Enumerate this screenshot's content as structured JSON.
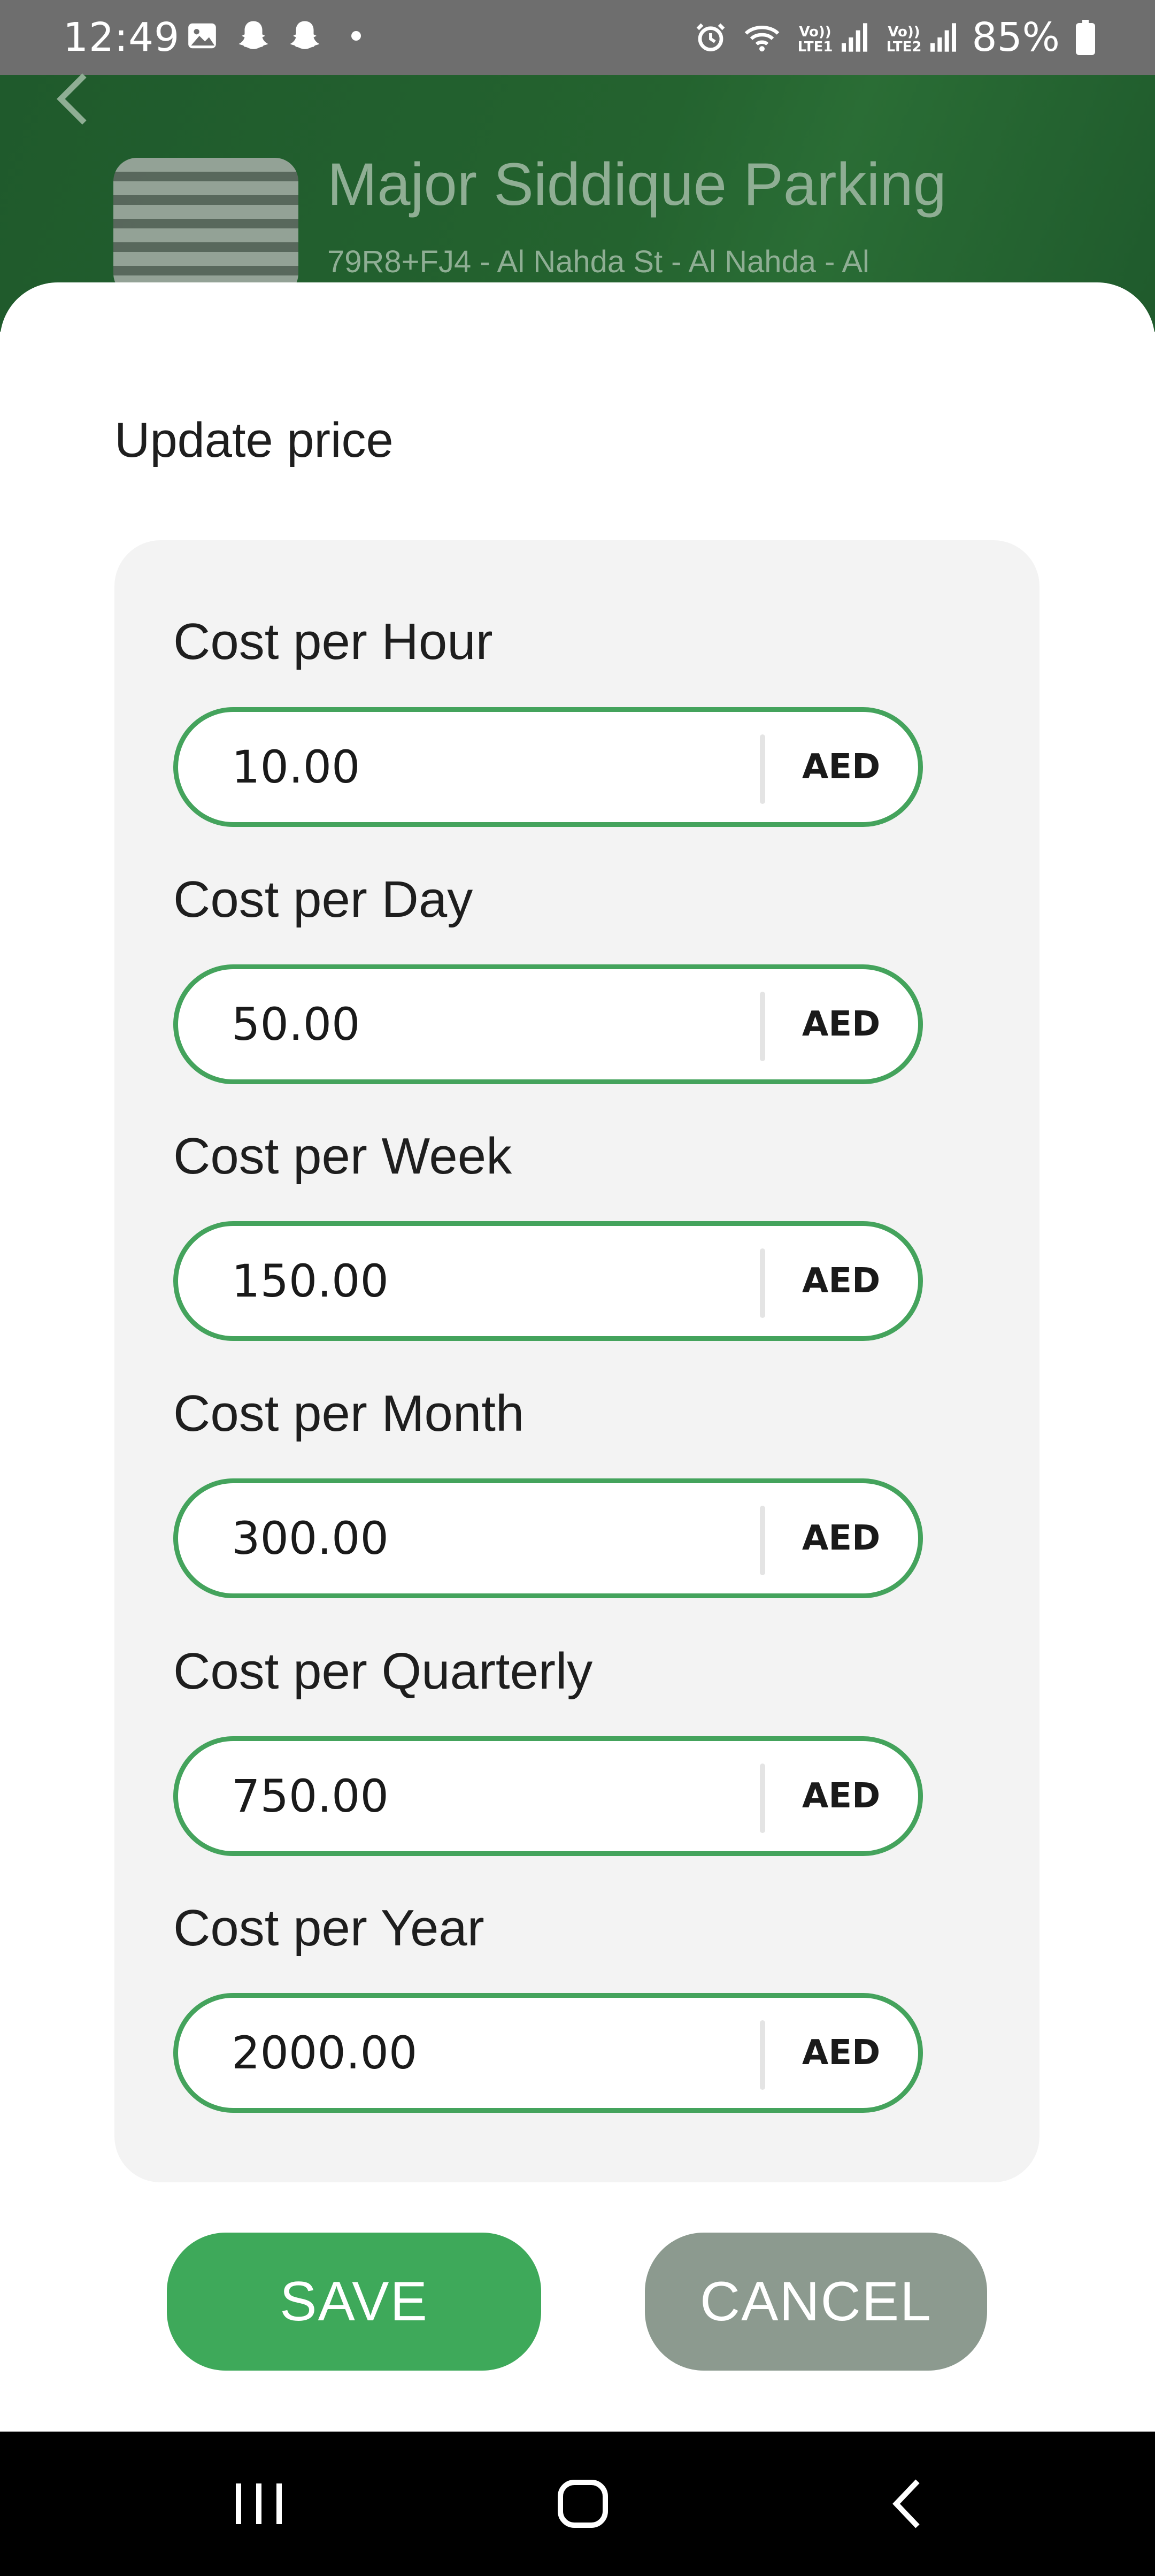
{
  "status_bar": {
    "time": "12:49",
    "left_icons": [
      "image-icon",
      "snapchat-icon",
      "snapchat-icon",
      "dot-icon"
    ],
    "right_icons": [
      "alarm-icon",
      "wifi-icon",
      "signal-lte1-icon",
      "signal-lte2-icon"
    ],
    "lte1_label": "Vo)) LTE1",
    "lte2_label": "Vo)) LTE2",
    "battery_percent": "85%"
  },
  "header": {
    "title": "Major Siddique Parking",
    "address": "79R8+FJ4 - Al Nahda St - Al Nahda - Al"
  },
  "dialog": {
    "title": "Update price",
    "fields": [
      {
        "label": "Cost per Hour",
        "value": "10.00",
        "unit": "AED"
      },
      {
        "label": "Cost per Day",
        "value": "50.00",
        "unit": "AED"
      },
      {
        "label": "Cost per Week",
        "value": "150.00",
        "unit": "AED"
      },
      {
        "label": "Cost per Month",
        "value": "300.00",
        "unit": "AED"
      },
      {
        "label": "Cost per Quarterly",
        "value": "750.00",
        "unit": "AED"
      },
      {
        "label": "Cost per Year",
        "value": "2000.00",
        "unit": "AED"
      }
    ],
    "save_label": "SAVE",
    "cancel_label": "CANCEL"
  },
  "colors": {
    "accent_green": "#44a35c",
    "save_button": "#3ea95a",
    "cancel_button": "#8c9a8f",
    "header_green": "#1f5a2c"
  },
  "nav_bar": {
    "icons": [
      "recent-apps-icon",
      "home-icon",
      "back-icon"
    ]
  }
}
